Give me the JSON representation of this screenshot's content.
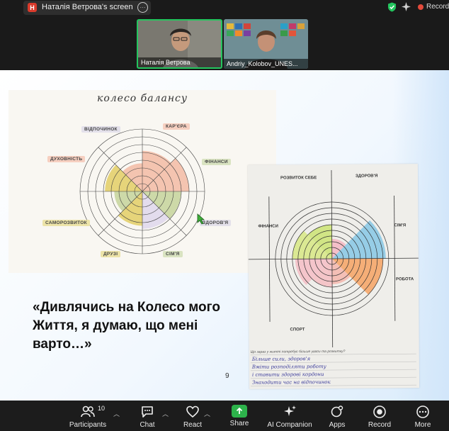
{
  "topbar": {
    "app_badge": "H",
    "share_title": "Наталія Ветрова's screen",
    "more_glyph": "···",
    "recording_label": "Recordi",
    "colors": {
      "secure": "#23c55e",
      "recording": "#e24a3b"
    }
  },
  "videos": [
    {
      "name": "Наталія Ветрова",
      "active_speaker": true
    },
    {
      "name": "Andriy_Kolobov_UNES...",
      "active_speaker": false
    }
  ],
  "slide": {
    "wheel_title": "колесо балансу",
    "wheel_labels": [
      "ВІДПОЧИНОК",
      "КАР'ЄРА",
      "ДУХОВНІСТЬ",
      "ФІНАНСИ",
      "САМОРОЗВИТОК",
      "ЗДОРОВ'Я",
      "ДРУЗІ",
      "СІМ'Я"
    ],
    "photo_labels": [
      "РОЗВИТОК СЕБЕ",
      "ЗДОРОВ'Я",
      "ФІНАНСИ",
      "СІМ'Я",
      "РОБОТА",
      "СПОРТ"
    ],
    "photo_question": "Що зараз у житті потребує більше уваги та розвитку?",
    "handwriting": [
      "Більше сили, здоров'я",
      "Вміти розподіляти роботу",
      "і ставити здорові кордони",
      "Знаходити час на відпочинок"
    ],
    "quote": "«Дивлячись на Колесо мого Життя, я думаю, що мені варто…»",
    "page_number": "9",
    "wheel_fill_levels": [
      0.65,
      0.75,
      0.62,
      0.6,
      0.55,
      0.45,
      0.6,
      0.45
    ]
  },
  "toolbar": {
    "participants_count": "10",
    "items": [
      {
        "label": "Participants",
        "icon": "participants-icon"
      },
      {
        "label": "Chat",
        "icon": "chat-icon"
      },
      {
        "label": "React",
        "icon": "heart-icon"
      },
      {
        "label": "Share",
        "icon": "share-arrow-icon"
      },
      {
        "label": "AI Companion",
        "icon": "sparkle-icon"
      },
      {
        "label": "Apps",
        "icon": "apps-icon"
      },
      {
        "label": "Record",
        "icon": "record-icon"
      },
      {
        "label": "More",
        "icon": "more-icon"
      }
    ]
  }
}
